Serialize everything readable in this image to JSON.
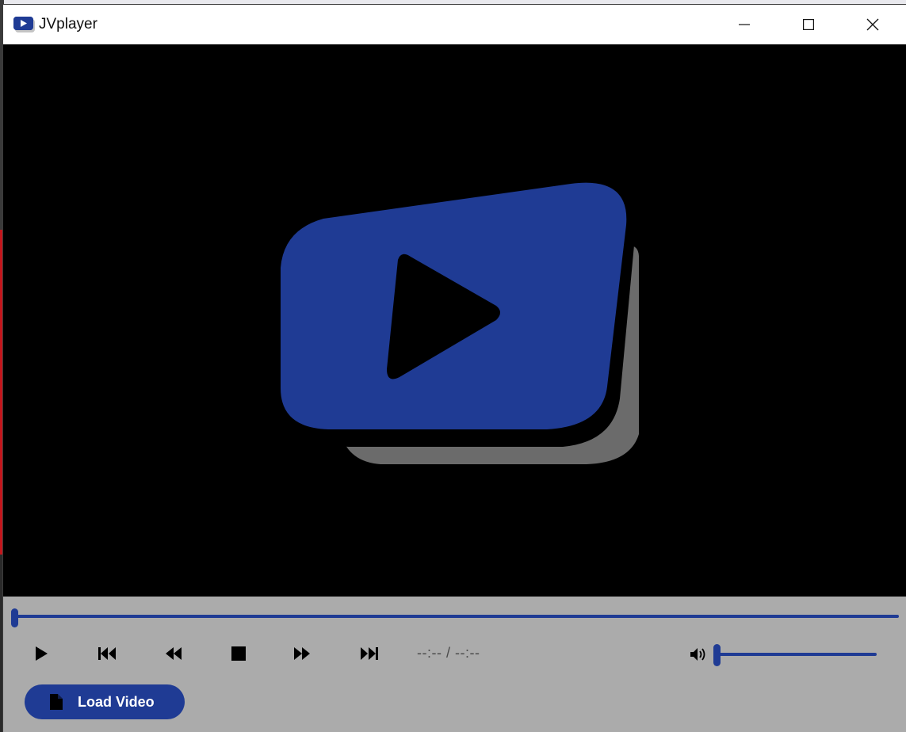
{
  "window": {
    "title": "JVplayer",
    "buttons": {
      "minimize_icon": "minimize-icon",
      "maximize_icon": "maximize-icon",
      "close_icon": "close-icon"
    }
  },
  "player": {
    "placeholder_logo": "jvplayer-logo",
    "seek_progress": 0,
    "time_display": "--:-- / --:--",
    "volume_level": 0,
    "controls": [
      {
        "name": "play-button",
        "icon": "play-icon"
      },
      {
        "name": "skip-previous-button",
        "icon": "skip-previous-icon"
      },
      {
        "name": "rewind-button",
        "icon": "rewind-icon"
      },
      {
        "name": "stop-button",
        "icon": "stop-icon"
      },
      {
        "name": "fast-forward-button",
        "icon": "fast-forward-icon"
      },
      {
        "name": "skip-next-button",
        "icon": "skip-next-icon"
      }
    ],
    "volume_icon": "volume-icon"
  },
  "load_button": {
    "label": "Load Video",
    "icon": "file-icon"
  },
  "colors": {
    "accent": "#1f3b94",
    "controls_bg": "#ababab",
    "video_bg": "#000000",
    "logo_shadow": "#6b6b6b"
  }
}
